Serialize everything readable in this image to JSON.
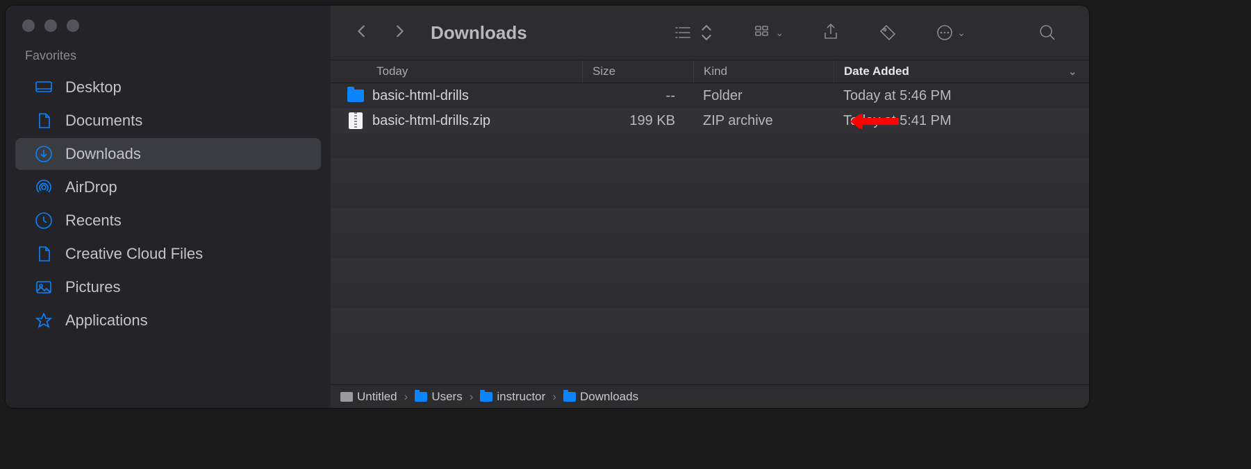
{
  "sidebar": {
    "section_label": "Favorites",
    "items": [
      {
        "label": "Desktop",
        "icon": "desktop",
        "active": false
      },
      {
        "label": "Documents",
        "icon": "document",
        "active": false
      },
      {
        "label": "Downloads",
        "icon": "download",
        "active": true
      },
      {
        "label": "AirDrop",
        "icon": "airdrop",
        "active": false
      },
      {
        "label": "Recents",
        "icon": "clock",
        "active": false
      },
      {
        "label": "Creative Cloud Files",
        "icon": "document",
        "active": false
      },
      {
        "label": "Pictures",
        "icon": "picture",
        "active": false
      },
      {
        "label": "Applications",
        "icon": "app",
        "active": false
      }
    ]
  },
  "toolbar": {
    "title": "Downloads"
  },
  "columns": {
    "name": "Today",
    "size": "Size",
    "kind": "Kind",
    "date": "Date Added"
  },
  "rows": [
    {
      "name": "basic-html-drills",
      "size": "--",
      "kind": "Folder",
      "date": "Today at 5:46 PM",
      "icon": "folder"
    },
    {
      "name": "basic-html-drills.zip",
      "size": "199 KB",
      "kind": "ZIP archive",
      "date": "Today at 5:41 PM",
      "icon": "zip"
    }
  ],
  "pathbar": [
    {
      "label": "Untitled",
      "icon": "disk"
    },
    {
      "label": "Users",
      "icon": "folder"
    },
    {
      "label": "instructor",
      "icon": "folder"
    },
    {
      "label": "Downloads",
      "icon": "folder"
    }
  ]
}
